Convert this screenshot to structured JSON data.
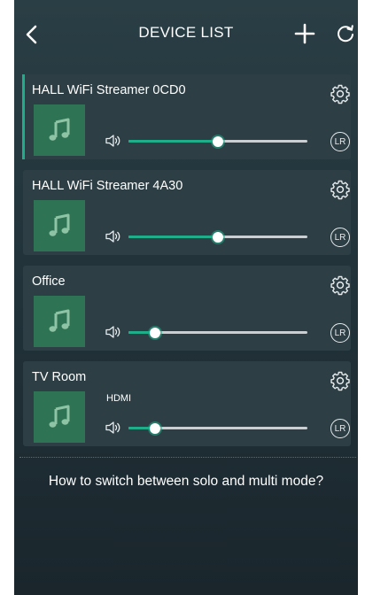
{
  "header": {
    "title": "DEVICE LIST"
  },
  "colors": {
    "accent": "#1fae8a",
    "card_background": "#2d3f45",
    "album_art": "#2e7454"
  },
  "devices": [
    {
      "name": "HALL WiFi Streamer 0CD0",
      "source": "",
      "volume_percent": 50,
      "selected": true,
      "channel_label": "LR",
      "icon": "music-note-icon"
    },
    {
      "name": "HALL WiFi Streamer 4A30",
      "source": "",
      "volume_percent": 50,
      "selected": false,
      "channel_label": "LR",
      "icon": "music-note-icon"
    },
    {
      "name": "Office",
      "source": "",
      "volume_percent": 15,
      "selected": false,
      "channel_label": "LR",
      "icon": "music-note-icon"
    },
    {
      "name": "TV Room",
      "source": "HDMI",
      "volume_percent": 15,
      "selected": false,
      "channel_label": "LR",
      "icon": "music-note-icon"
    }
  ],
  "help_link": "How to switch between solo and multi mode?"
}
